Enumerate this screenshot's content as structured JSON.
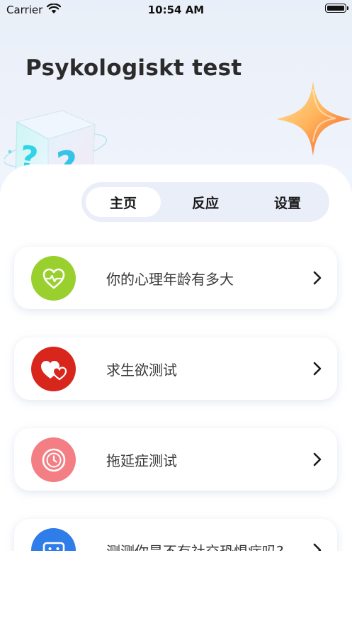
{
  "status_bar": {
    "carrier": "Carrier",
    "time": "10:54 AM"
  },
  "header": {
    "title": "Psykologiskt test"
  },
  "tabs": [
    {
      "label": "主页",
      "active": true
    },
    {
      "label": "反应",
      "active": false
    },
    {
      "label": "设置",
      "active": false
    }
  ],
  "cards": [
    {
      "label": "你的心理年龄有多大",
      "icon": "heart-pulse-icon",
      "color": "#9ad02e"
    },
    {
      "label": "求生欲测试",
      "icon": "hearts-icon",
      "color": "#d9261c"
    },
    {
      "label": "拖延症测试",
      "icon": "clock-icon",
      "color": "#f37f85"
    },
    {
      "label": "测测你是不有社交恐惧症吗?",
      "icon": "robot-face-icon",
      "color": "#2e7de8"
    }
  ]
}
